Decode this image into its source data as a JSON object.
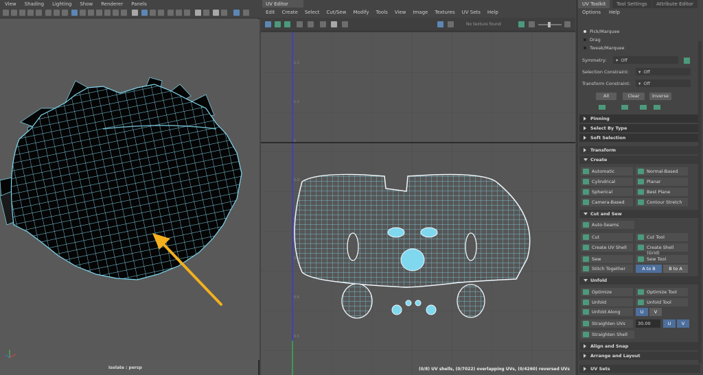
{
  "viewport": {
    "menu": [
      "View",
      "Shading",
      "Lighting",
      "Show",
      "Renderer",
      "Panels"
    ],
    "footer": "Isolate : persp"
  },
  "uv_editor": {
    "tab": "UV Editor",
    "menu": [
      "Edit",
      "Create",
      "Select",
      "Cut/Sew",
      "Modify",
      "Tools",
      "View",
      "Image",
      "Textures",
      "UV Sets",
      "Help"
    ],
    "texture_label": "No texture found",
    "axis_labels": [
      "1.2",
      "1.1",
      "1",
      "0.9",
      "0.8",
      "0.7",
      "0.6",
      "0.5"
    ],
    "status": "(0/8) UV shells, (0/7022) overlapping UVs, (0/4260) reversed UVs"
  },
  "toolkit": {
    "tabs": [
      "UV Toolkit",
      "Tool Settings",
      "Attribute Editor"
    ],
    "submenu": [
      "Options",
      "Help"
    ],
    "modes": [
      "Pick/Marquee",
      "Drag",
      "Tweak/Marquee"
    ],
    "symmetry_label": "Symmetry:",
    "symmetry_value": "Off",
    "selection_constraint_label": "Selection Constraint:",
    "selection_constraint_value": "Off",
    "transform_constraint_label": "Transform Constraint:",
    "transform_constraint_value": "Off",
    "buttons": {
      "all": "All",
      "clear": "Clear",
      "inverse": "Inverse"
    },
    "sections": {
      "pinning": "Pinning",
      "select_by_type": "Select By Type",
      "soft_selection": "Soft Selection",
      "transform": "Transform",
      "create": "Create",
      "cut_and_sew": "Cut and Sew",
      "unfold": "Unfold",
      "align_and_snap": "Align and Snap",
      "arrange_and_layout": "Arrange and Layout",
      "uv_sets": "UV Sets"
    },
    "create_tools": [
      "Automatic",
      "Normal-Based",
      "Cylindrical",
      "Planar",
      "Spherical",
      "Best Plane",
      "Camera-Based",
      "Contour Stretch"
    ],
    "cut_sew": {
      "auto_seams": "Auto-Seams",
      "cut": "Cut",
      "cut_tool": "Cut Tool",
      "create_uv_shell": "Create UV Shell",
      "create_shell_grid": "Create Shell (Grid)",
      "sew": "Sew",
      "sew_tool": "Sew Tool",
      "stitch_together": "Stitch Together",
      "a_to_b": "A to B",
      "b_to_a": "B to A"
    },
    "unfold_tools": {
      "optimize": "Optimize",
      "optimize_tool": "Optimize Tool",
      "unfold": "Unfold",
      "unfold_tool": "Unfold Tool",
      "unfold_along": "Unfold Along",
      "u": "U",
      "v": "V",
      "straighten_uvs": "Straighten UVs",
      "straighten_value": "30.00",
      "straighten_shell": "Straighten Shell"
    }
  },
  "colors": {
    "wire": "#7fd8ee",
    "accent": "#4e6f9c",
    "arrow": "#f2b01e"
  }
}
